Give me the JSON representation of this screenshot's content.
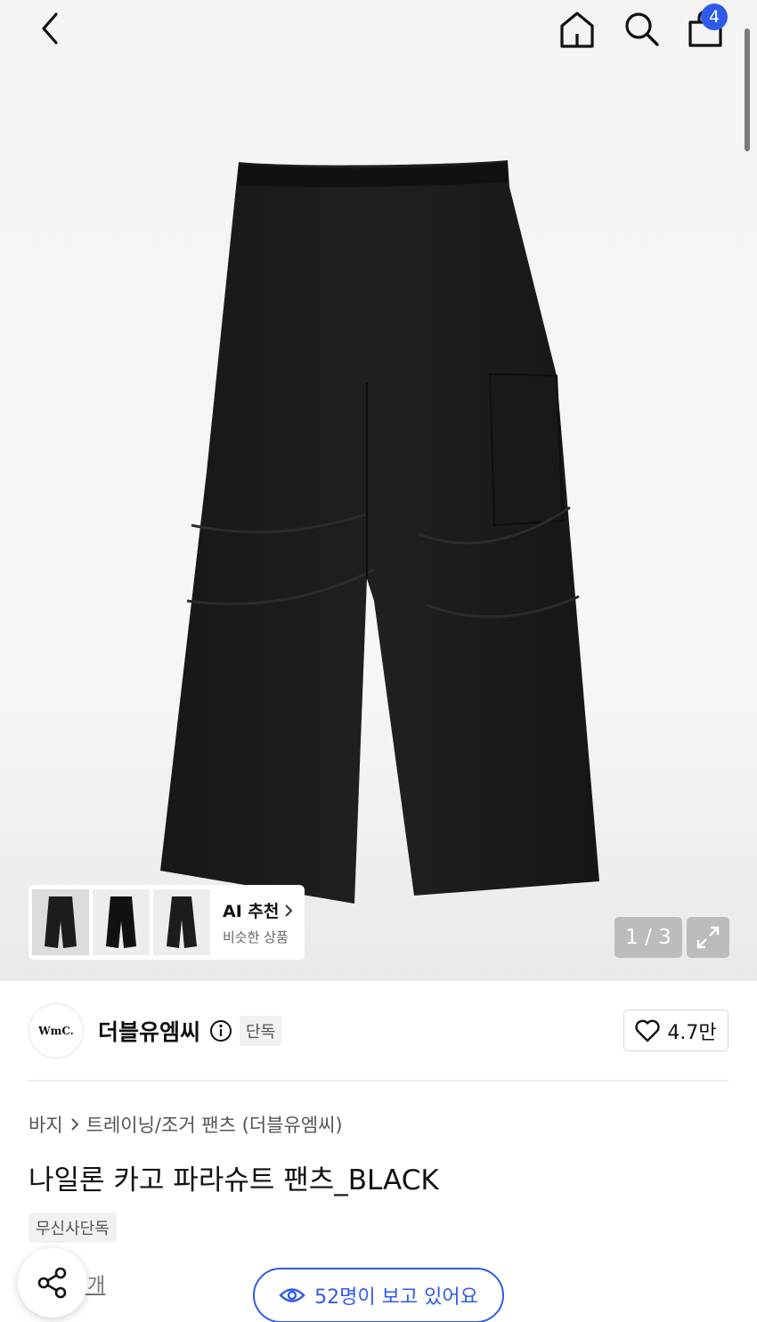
{
  "header": {
    "back_icon": "chevron-left-icon",
    "home_icon": "home-icon",
    "search_icon": "search-icon",
    "cart_icon": "shopping-bag-icon",
    "cart_count": "4"
  },
  "gallery": {
    "counter": "1 / 3",
    "expand_icon": "expand-icon",
    "ai_recommend": {
      "title": "AI 추천",
      "subtitle": "비슷한 상품"
    }
  },
  "brand": {
    "logo_text": "WmC.",
    "name": "더블유엠씨",
    "exclusive_badge": "단독",
    "likes": "4.7만"
  },
  "breadcrumb": {
    "level1": "바지",
    "level2": "트레이닝/조거 팬츠 (더블유엠씨)"
  },
  "product": {
    "title": "나일론 카고 파라슈트 팬츠_BLACK",
    "tag": "무신사단독"
  },
  "footer": {
    "count_link": "1개",
    "viewers": "52명이 보고 있어요"
  },
  "colors": {
    "accent": "#2f5bea",
    "pants": "#1b1c1e"
  }
}
